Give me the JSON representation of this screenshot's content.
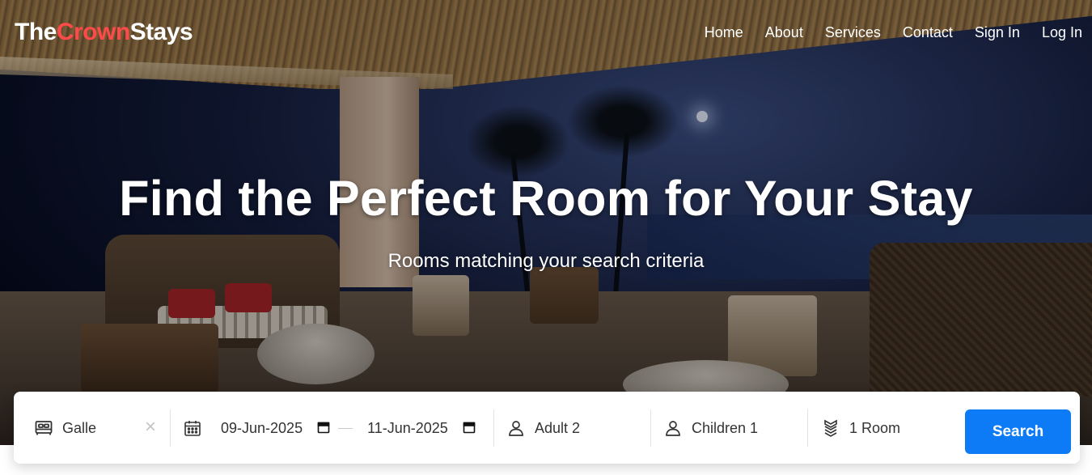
{
  "brand": {
    "part1": "The",
    "accent": "Crown",
    "part2": "Stays",
    "accent_color": "#ff4a4a"
  },
  "nav": {
    "items": [
      {
        "label": "Home"
      },
      {
        "label": "About"
      },
      {
        "label": "Services"
      },
      {
        "label": "Contact"
      },
      {
        "label": "Sign In"
      },
      {
        "label": "Log In"
      }
    ]
  },
  "hero": {
    "title": "Find the Perfect Room for Your Stay",
    "subtitle": "Rooms matching your search criteria"
  },
  "search": {
    "location": {
      "value": "Galle",
      "icon": "bed-icon",
      "clear_icon": "close-icon"
    },
    "checkin": {
      "value": "09-Jun-2025",
      "icon": "calendar-icon"
    },
    "checkout": {
      "value": "11-Jun-2025"
    },
    "adults": {
      "value": "Adult 2",
      "icon": "person-icon"
    },
    "children": {
      "value": "Children 1",
      "icon": "person-icon"
    },
    "rooms": {
      "value": "1 Room",
      "icon": "layers-icon"
    },
    "button_label": "Search",
    "button_color": "#0d7bf6"
  }
}
